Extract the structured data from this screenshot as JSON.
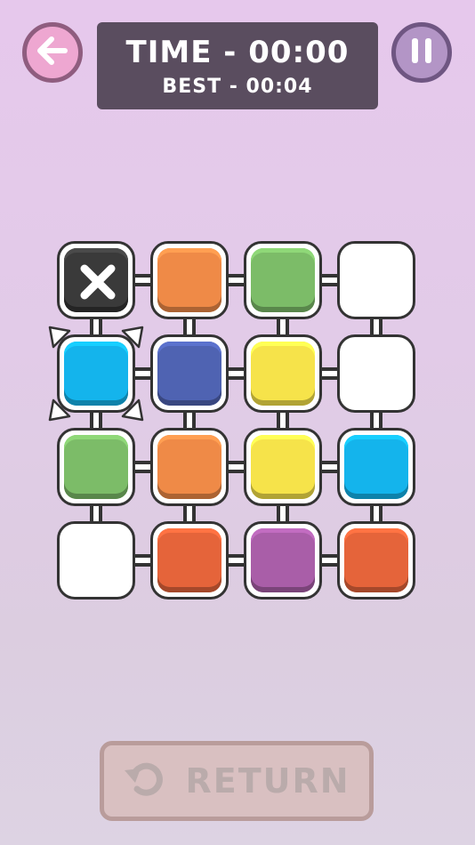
{
  "header": {
    "back_button": {
      "icon": "arrow-left-icon",
      "color": "#eea7d1"
    },
    "pause_button": {
      "icon": "pause-icon",
      "color": "#b395c6"
    },
    "time_label": "TIME - 00:00",
    "best_label": "BEST - 00:04"
  },
  "board": {
    "rows": 4,
    "cols": 4,
    "selected": {
      "row": 1,
      "col": 0
    },
    "tiles": [
      [
        {
          "type": "blocked",
          "color": "#333333",
          "icon": "close-icon"
        },
        {
          "type": "color",
          "color": "#ef8a47"
        },
        {
          "type": "color",
          "color": "#7cbc68"
        },
        {
          "type": "empty",
          "color": "#ffffff"
        }
      ],
      [
        {
          "type": "color",
          "color": "#14b4ec"
        },
        {
          "type": "color",
          "color": "#4f63b2"
        },
        {
          "type": "color",
          "color": "#f6e34a"
        },
        {
          "type": "empty",
          "color": "#ffffff"
        }
      ],
      [
        {
          "type": "color",
          "color": "#7cbc68"
        },
        {
          "type": "color",
          "color": "#ef8a47"
        },
        {
          "type": "color",
          "color": "#f6e34a"
        },
        {
          "type": "color",
          "color": "#14b4ec"
        }
      ],
      [
        {
          "type": "empty",
          "color": "#ffffff"
        },
        {
          "type": "color",
          "color": "#e5643a"
        },
        {
          "type": "color",
          "color": "#a95ea8"
        },
        {
          "type": "color",
          "color": "#e5643a"
        }
      ]
    ]
  },
  "footer": {
    "return_label": "RETURN",
    "return_icon": "rotate-ccw-icon"
  }
}
